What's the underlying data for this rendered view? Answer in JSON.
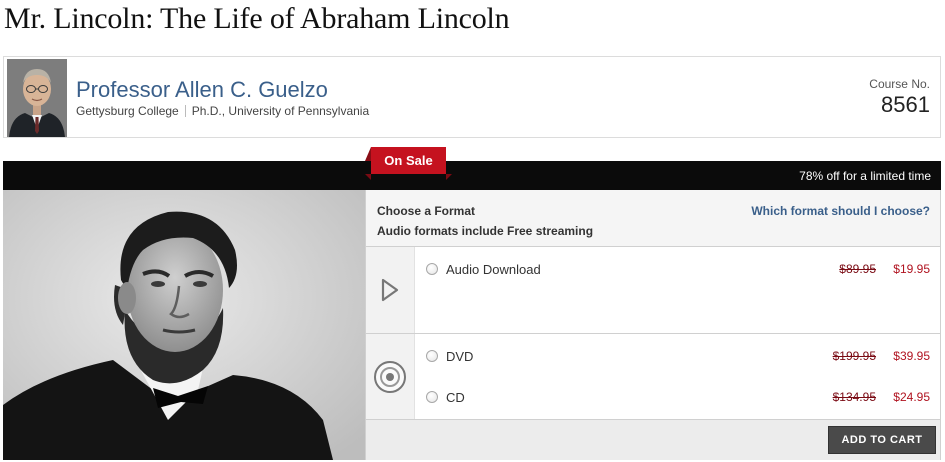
{
  "course": {
    "title": "Mr. Lincoln: The Life of Abraham Lincoln",
    "number_label": "Course No.",
    "number": "8561"
  },
  "professor": {
    "name": "Professor Allen C. Guelzo",
    "institution": "Gettysburg College",
    "degree": "Ph.D., University of Pennsylvania"
  },
  "sale": {
    "badge": "On Sale",
    "banner": "78% off for a limited time"
  },
  "formats": {
    "heading": "Choose a Format",
    "subheading": "Audio formats include Free streaming",
    "help_link": "Which format should I choose?",
    "options": [
      {
        "label": "Audio Download",
        "old_price": "$89.95",
        "new_price": "$19.95",
        "selected": false,
        "icon": "play-icon"
      },
      {
        "label": "DVD",
        "old_price": "$199.95",
        "new_price": "$39.95",
        "selected": false,
        "icon": "disc-icon"
      },
      {
        "label": "CD",
        "old_price": "$134.95",
        "new_price": "$24.95",
        "selected": false,
        "icon": "disc-icon"
      }
    ]
  },
  "cart": {
    "button": "ADD TO CART"
  },
  "colors": {
    "link_blue": "#3a5f8a",
    "sale_red": "#c5121f",
    "price_red": "#b0121f",
    "banner_black": "#0b0b0b"
  }
}
